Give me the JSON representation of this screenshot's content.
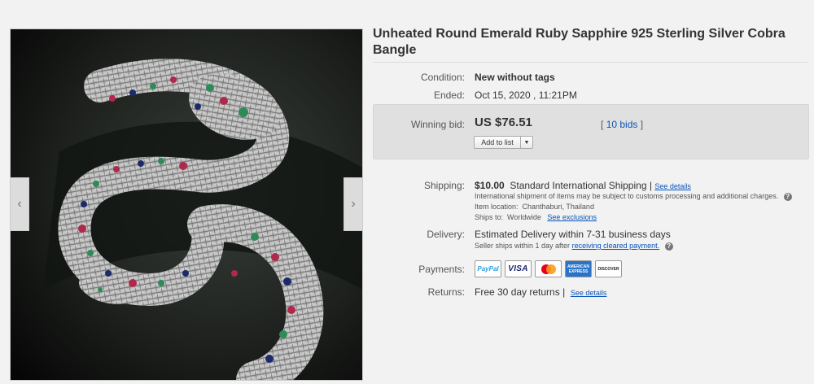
{
  "gallery": {
    "prev_icon": "chevron-left-icon",
    "next_icon": "chevron-right-icon",
    "prev_glyph": "‹",
    "next_glyph": "›"
  },
  "listing": {
    "title": "Unheated Round Emerald Ruby Sapphire 925 Sterling Silver Cobra Bangle"
  },
  "condition": {
    "label": "Condition:",
    "value": "New without tags"
  },
  "ended": {
    "label": "Ended:",
    "value": "Oct 15, 2020 , 11:21PM"
  },
  "bid": {
    "label": "Winning bid:",
    "price": "US $76.51",
    "bids_open": "[",
    "bids_count": "10 bids",
    "bids_close": "]",
    "add_to_list": "Add to list",
    "dropdown_glyph": "▼"
  },
  "shipping": {
    "label": "Shipping:",
    "cost": "$10.00",
    "method": "Standard International Shipping",
    "separator": "|",
    "see_details": "See details",
    "notice": "International shipment of items may be subject to customs processing and additional charges.",
    "help_glyph": "?",
    "item_location_label": "Item location:",
    "item_location": "Chanthaburi, Thailand",
    "ships_to_label": "Ships to:",
    "ships_to": "Worldwide",
    "see_exclusions": "See exclusions"
  },
  "delivery": {
    "label": "Delivery:",
    "estimate": "Estimated Delivery within 7-31 business days",
    "seller_ships": "Seller ships within 1 day after",
    "cleared_payment": "receiving cleared payment.",
    "help_glyph": "?"
  },
  "payments": {
    "label": "Payments:",
    "methods": [
      "PayPal",
      "VISA",
      "Mastercard",
      "AMERICAN EXPRESS",
      "DISCOVER"
    ]
  },
  "returns": {
    "label": "Returns:",
    "value": "Free 30 day returns",
    "separator": "|",
    "see_details": "See details"
  },
  "colors": {
    "link": "#0654ba",
    "bid_box": "#e0e0e0",
    "page_bg": "#f2f2f2"
  }
}
